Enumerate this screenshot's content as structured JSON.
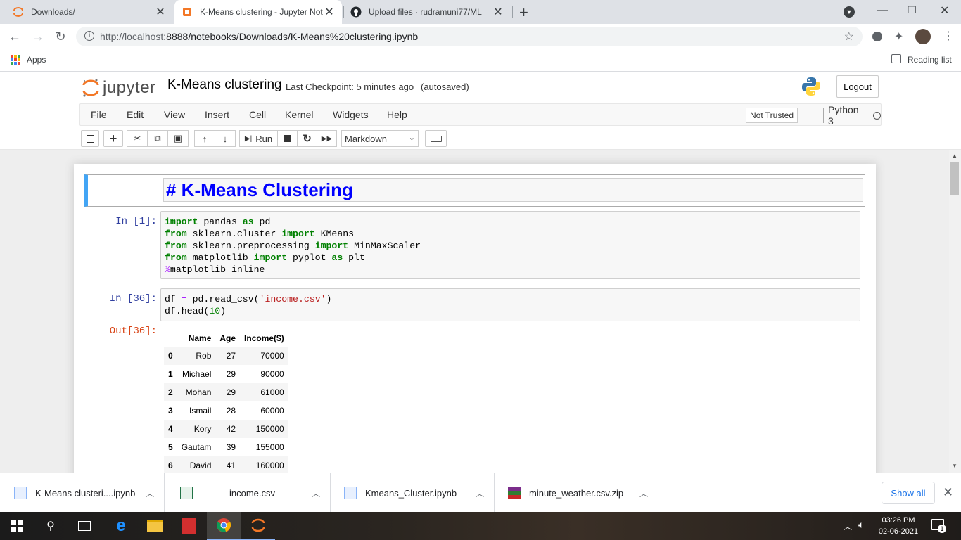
{
  "browser": {
    "tabs": [
      {
        "title": "Downloads/",
        "icon": "jupyter-icon",
        "active": false
      },
      {
        "title": "K-Means clustering - Jupyter Not",
        "icon": "jupyter-icon",
        "active": true
      },
      {
        "title": "Upload files · rudramuni77/ML",
        "icon": "github-icon",
        "active": false
      }
    ],
    "new_tab": "+",
    "url_host": "http://localhost",
    "url_rest": ":8888/notebooks/Downloads/K-Means%20clustering.ipynb",
    "bookmarks_apps": "Apps",
    "reading_list": "Reading list"
  },
  "jupyter": {
    "logo_text": "jupyter",
    "notebook_title": "K-Means clustering",
    "checkpoint": "Last Checkpoint: 5 minutes ago",
    "autosave": "(autosaved)",
    "logout": "Logout",
    "menu": [
      "File",
      "Edit",
      "View",
      "Insert",
      "Cell",
      "Kernel",
      "Widgets",
      "Help"
    ],
    "trusted": "Not Trusted",
    "kernel": "Python 3",
    "run_label": "Run",
    "cell_type": "Markdown"
  },
  "cells": {
    "markdown": "# K-Means Clustering",
    "in1_prompt": "In [1]:",
    "in36_prompt": "In [36]:",
    "out36_prompt": "Out[36]:"
  },
  "dataframe": {
    "columns": [
      "",
      "Name",
      "Age",
      "Income($)"
    ],
    "rows": [
      [
        "0",
        "Rob",
        "27",
        "70000"
      ],
      [
        "1",
        "Michael",
        "29",
        "90000"
      ],
      [
        "2",
        "Mohan",
        "29",
        "61000"
      ],
      [
        "3",
        "Ismail",
        "28",
        "60000"
      ],
      [
        "4",
        "Kory",
        "42",
        "150000"
      ],
      [
        "5",
        "Gautam",
        "39",
        "155000"
      ],
      [
        "6",
        "David",
        "41",
        "160000"
      ]
    ]
  },
  "downloads": {
    "items": [
      "K-Means clusteri....ipynb",
      "income.csv",
      "Kmeans_Cluster.ipynb",
      "minute_weather.csv.zip"
    ],
    "show_all": "Show all"
  },
  "taskbar": {
    "time": "03:26 PM",
    "date": "02-06-2021",
    "notifications": "1"
  },
  "colors": {
    "jupyter_orange": "#f37726",
    "selected_cell_border": "#42a5f5",
    "markdown_heading": "#0000ff",
    "in_prompt": "#303f9f",
    "out_prompt": "#d84315"
  }
}
